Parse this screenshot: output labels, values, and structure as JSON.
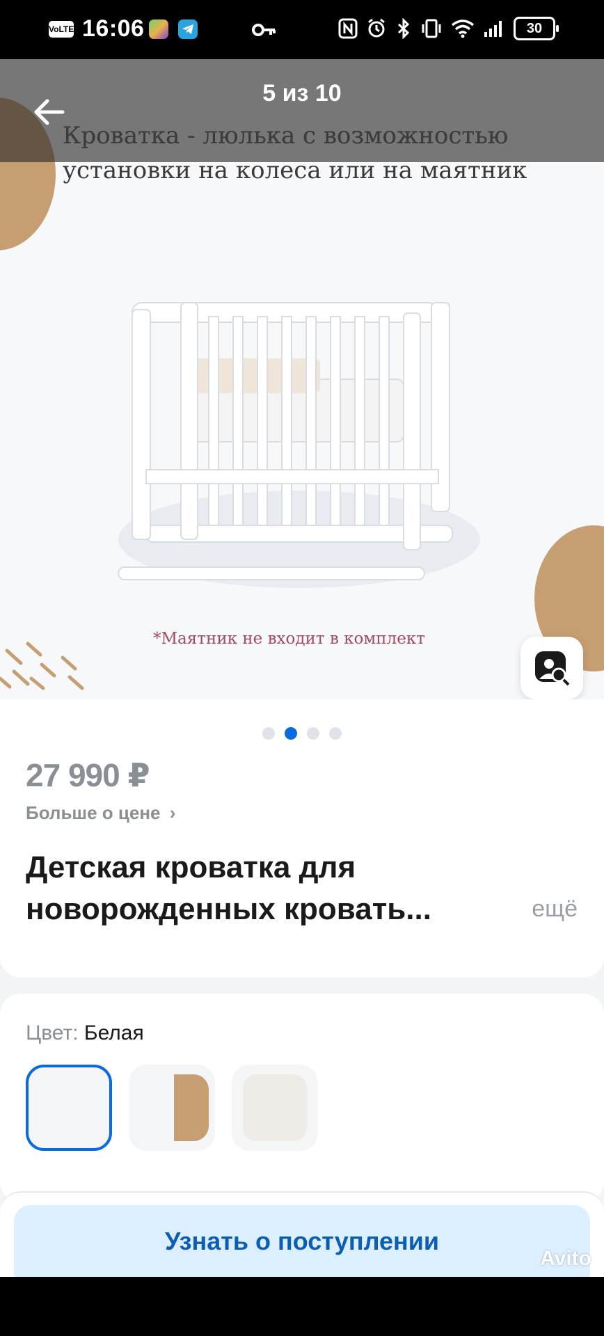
{
  "status_bar": {
    "time": "16:06",
    "volte": "VoLTE",
    "battery": "30",
    "icons": [
      "game-app-icon",
      "telegram-icon",
      "vpn-key-icon",
      "nfc-icon",
      "alarm-icon",
      "bluetooth-icon",
      "vibrate-icon",
      "wifi-icon",
      "signal-icon"
    ]
  },
  "gallery": {
    "counter": "5 из 10",
    "caption_line1": "Кроватка - люлька с возможностью",
    "caption_line2": "установки на колеса или на маятник",
    "note": "*Маятник не входит в комплект",
    "page_dots": 4,
    "active_dot": 2
  },
  "product": {
    "price": "27 990 ₽",
    "price_more": "Больше о цене",
    "title": "Детская кроватка для новорожденных кровать...",
    "more": "ещё"
  },
  "color": {
    "label": "Цвет:",
    "value": "Белая",
    "swatches": [
      "white",
      "white-brown",
      "beige"
    ],
    "selected": 0
  },
  "actions": {
    "notify": "Узнать о поступлении"
  },
  "watermark": "Avito",
  "colors": {
    "accent": "#0a6be0",
    "accent_soft": "#dcefff",
    "wood": "#c79e72"
  }
}
